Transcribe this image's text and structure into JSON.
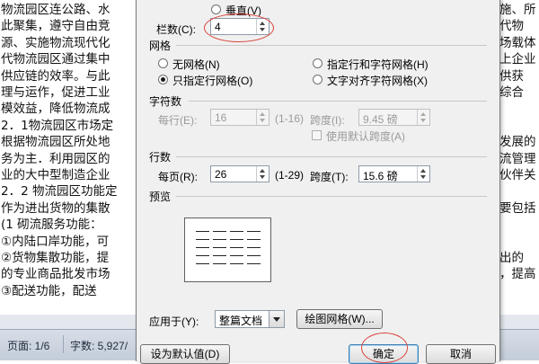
{
  "document": {
    "left_lines": [
      "物流园区连公路、水",
      "此聚集，遵守自由竞",
      "源、实施物流现代化",
      "代物流园区通过集中",
      "供应链的效率。与此",
      "理与运作，促进工业",
      "模效益，降低物流成",
      "2．1物流园区市场定",
      "根据物流园区所处地",
      "务为主．利用园区的",
      "业的大中型制造企业",
      "2．2 物流园区功能定",
      "作为进出货物的集散",
      "(1 砌流服务功能：",
      "①内陆口岸功能，可",
      "②货物集散功能，提",
      "的专业商品批发市场",
      "③配送功能，配送"
    ],
    "right_lines": [
      "施、所",
      "代物",
      "场载体",
      "上企业",
      "供获",
      "综合",
      "",
      "",
      "发展的",
      "流管理",
      "伙伴关",
      "",
      "要包括",
      "",
      "",
      "出的",
      "，提高",
      ""
    ]
  },
  "statusbar": {
    "page": "页面: 1/6",
    "words": "字数: 5,927/"
  },
  "dialog": {
    "vertical_label": "垂直(V)",
    "columns_label": "栏数(C):",
    "columns_value": "4",
    "grid_section": "网格",
    "grid_none": "无网格(N)",
    "grid_lines": "只指定行网格(O)",
    "grid_lines_chars": "指定行和字符网格(H)",
    "grid_align": "文字对齐字符网格(X)",
    "chars_section": "字符数",
    "chars_per_line_label": "每行(E):",
    "chars_per_line_value": "16",
    "chars_range": "(1-16)",
    "chars_pitch_label": "跨度(I):",
    "chars_pitch_value": "9.45 磅",
    "use_default_pitch": "使用默认跨度(A)",
    "lines_section": "行数",
    "lines_per_page_label": "每页(R):",
    "lines_per_page_value": "26",
    "lines_range": "(1-29)",
    "lines_pitch_label": "跨度(T):",
    "lines_pitch_value": "15.6 磅",
    "preview_section": "预览",
    "apply_to_label": "应用于(Y):",
    "apply_to_value": "整篇文档",
    "draw_grid_button": "绘图网格(W)...",
    "set_default_button": "设为默认值(D)",
    "ok_button": "确定",
    "cancel_button": "取消"
  },
  "colors": {
    "annotation": "#d9443a",
    "dialog_bg": "#f0f0f0"
  }
}
